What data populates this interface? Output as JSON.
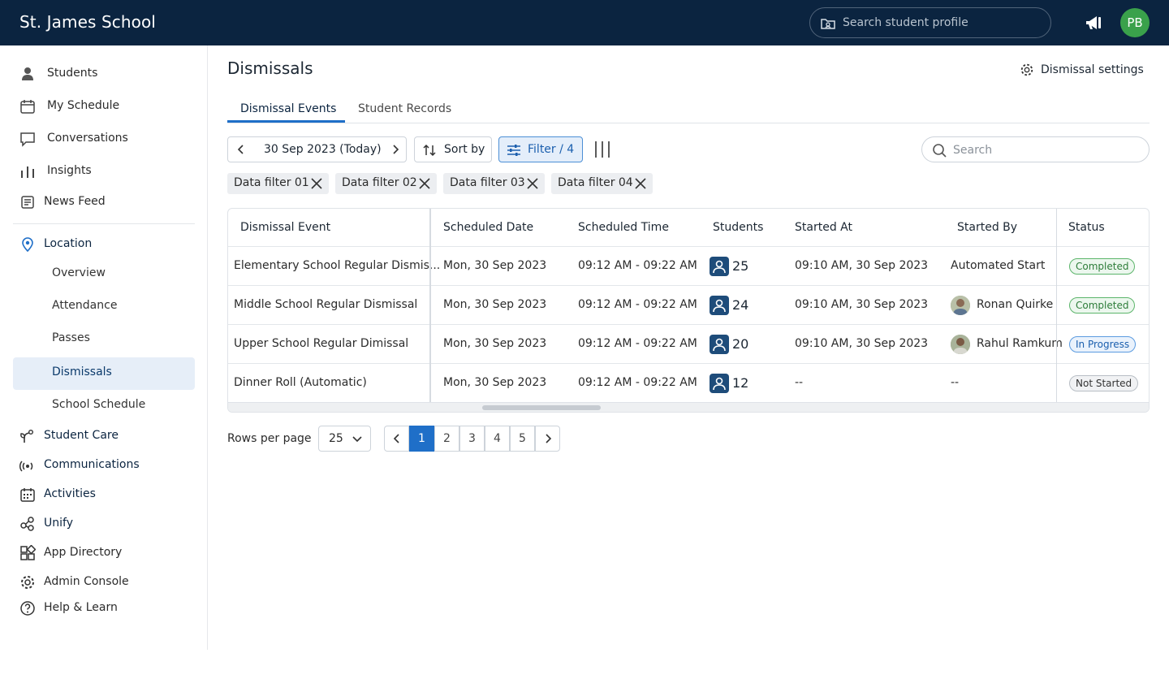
{
  "header": {
    "school_name": "St. James School",
    "search_placeholder": "Search student profile",
    "user_initials": "PB",
    "avatar_color": "#3aa14b"
  },
  "sidebar": {
    "items": [
      {
        "label": "Students",
        "icon": "person-icon"
      },
      {
        "label": "My Schedule",
        "icon": "calendar-icon"
      },
      {
        "label": "Conversations",
        "icon": "chat-icon"
      },
      {
        "label": "Insights",
        "icon": "bars-icon"
      },
      {
        "label": "News Feed",
        "icon": "newspaper-icon"
      }
    ],
    "location": {
      "label": "Location",
      "subitems": [
        "Overview",
        "Attendance",
        "Passes",
        "Dismissals",
        "School Schedule"
      ],
      "active": "Dismissals"
    },
    "sections": [
      {
        "label": "Student Care",
        "icon": "sprout-icon"
      },
      {
        "label": "Communications",
        "icon": "broadcast-icon"
      },
      {
        "label": "Activities",
        "icon": "calendar-grid-icon"
      },
      {
        "label": "Unify",
        "icon": "nodes-icon"
      },
      {
        "label": "App Directory",
        "icon": "apps-icon"
      },
      {
        "label": "Admin Console",
        "icon": "gear-icon"
      },
      {
        "label": "Help & Learn",
        "icon": "help-icon"
      }
    ]
  },
  "page": {
    "title": "Dismissals",
    "settings_label": "Dismissal settings",
    "tabs": [
      "Dismissal Events",
      "Student Records"
    ],
    "active_tab": "Dismissal Events"
  },
  "toolbar": {
    "date_label": "30 Sep 2023 (Today)",
    "sort_label": "Sort by",
    "filter_label": "Filter / 4",
    "search_placeholder": "Search"
  },
  "filters": [
    "Data filter 01",
    "Data filter 02",
    "Data filter 03",
    "Data filter 04"
  ],
  "table": {
    "columns": [
      "Dismissal Event",
      "Scheduled Date",
      "Scheduled Time",
      "Students",
      "Started At",
      "Started By",
      "Status"
    ],
    "rows": [
      {
        "event": "Elementary School Regular Dismis...",
        "date": "Mon, 30 Sep 2023",
        "time": "09:12 AM - 09:22 AM",
        "students": "25",
        "started_at": "09:10 AM, 30 Sep 2023",
        "started_by": "Automated Start",
        "has_avatar": false,
        "status": "Completed",
        "status_kind": "done"
      },
      {
        "event": "Middle School Regular Dismissal",
        "date": "Mon, 30 Sep 2023",
        "time": "09:12 AM - 09:22 AM",
        "students": "24",
        "started_at": "09:10 AM, 30 Sep 2023",
        "started_by": "Ronan Quirke",
        "has_avatar": true,
        "status": "Completed",
        "status_kind": "done"
      },
      {
        "event": "Upper School Regular Dimissal",
        "date": "Mon, 30 Sep 2023",
        "time": "09:12 AM - 09:22 AM",
        "students": "20",
        "started_at": "09:10 AM, 30 Sep 2023",
        "started_by": "Rahul Ramkum",
        "has_avatar": true,
        "status": "In Progress",
        "status_kind": "prog"
      },
      {
        "event": "Dinner Roll (Automatic)",
        "date": "Mon, 30 Sep 2023",
        "time": "09:12 AM - 09:22 AM",
        "students": "12",
        "started_at": "--",
        "started_by": "--",
        "has_avatar": false,
        "status": "Not Started",
        "status_kind": "not"
      }
    ]
  },
  "pagination": {
    "rows_per_page_label": "Rows per page",
    "rows_per_page": "25",
    "pages": [
      "1",
      "2",
      "3",
      "4",
      "5"
    ],
    "current_page": "1"
  }
}
